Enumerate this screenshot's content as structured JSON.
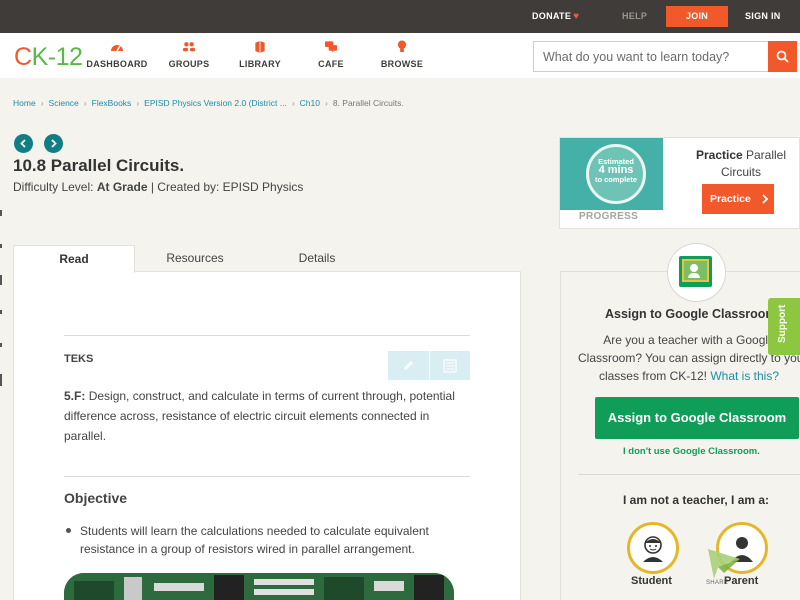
{
  "topbar": {
    "donate": "DONATE",
    "help": "HELP",
    "join": "JOIN",
    "signin": "SIGN IN"
  },
  "logo": {
    "c": "C",
    "k": "K",
    "dash": "-",
    "num": "12"
  },
  "nav": {
    "dashboard": "DASHBOARD",
    "groups": "GROUPS",
    "library": "LIBRARY",
    "cafe": "CAFE",
    "browse": "BROWSE"
  },
  "search": {
    "placeholder": "What do you want to learn today?"
  },
  "breadcrumb": {
    "home": "Home",
    "science": "Science",
    "flexbooks": "FlexBooks",
    "book": "EPISD Physics Version 2.0 (District ...",
    "chapter": "Ch10",
    "current": "8. Parallel Circuits."
  },
  "lesson": {
    "title": "10.8 Parallel Circuits.",
    "difficulty_label": "Difficulty Level:",
    "difficulty_value": "At Grade",
    "created_by": "| Created by: EPISD Physics"
  },
  "tabs": {
    "read": "Read",
    "resources": "Resources",
    "details": "Details"
  },
  "teks": {
    "label": "TEKS",
    "code": "5.F:",
    "text": "Design, construct, and calculate in terms of current through, potential difference across, resistance of electric circuit elements connected in parallel."
  },
  "objective": {
    "label": "Objective",
    "bullet": "Students will learn the calculations needed to calculate equivalent resistance in a group of resistors wired in parallel arrangement."
  },
  "practice": {
    "estimated": "Estimated",
    "minutes": "4 mins",
    "to_complete": "to complete",
    "progress": "PROGRESS",
    "title_bold": "Practice",
    "title_rest": " Parallel Circuits",
    "button": "Practice"
  },
  "assign": {
    "title": "Assign to Google Classroom",
    "line1": "Are you a teacher with a Google",
    "line2": "Classroom? You can assign directly to your",
    "line3_pre": "classes from CK-12! ",
    "link": "What is this?",
    "button": "Assign to Google Classroom",
    "dont_use": "I don't use Google Classroom.",
    "not_teacher": "I am not a teacher, I am a:",
    "student": "Student",
    "parent": "Parent"
  },
  "support": "Support",
  "share": "SHARE",
  "colors": {
    "brand_orange": "#f1592a",
    "brand_green": "#5ab946",
    "teal": "#117e86",
    "google_green": "#0f9d58",
    "topbar": "#3f3c39"
  }
}
